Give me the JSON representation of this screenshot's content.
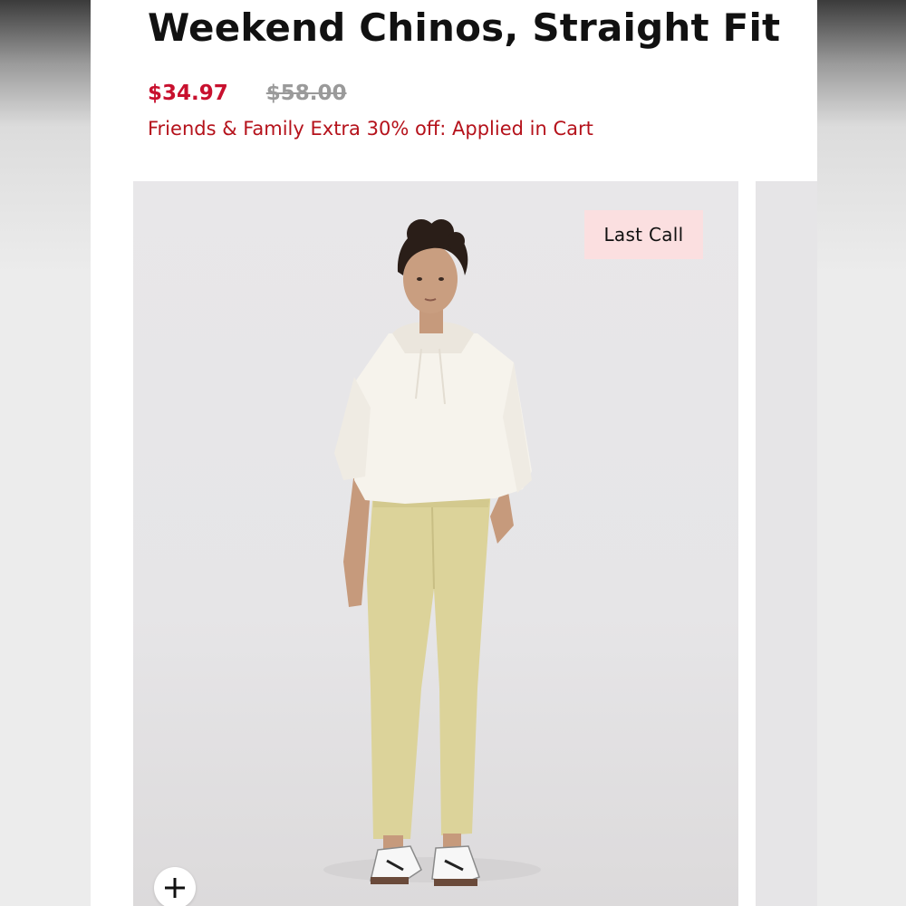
{
  "product": {
    "title": "Weekend Chinos, Straight Fit",
    "price_sale": "$34.97",
    "price_original": "$58.00",
    "promo": "Friends & Family Extra 30% off: Applied in Cart"
  },
  "gallery": {
    "badge": "Last Call",
    "zoom_icon": "plus-icon",
    "image": "model-photo"
  },
  "colors": {
    "sale_red": "#c8102e",
    "promo_red": "#b5121b",
    "badge_bg": "#fbdfe0",
    "original_grey": "#9a9a9a"
  }
}
